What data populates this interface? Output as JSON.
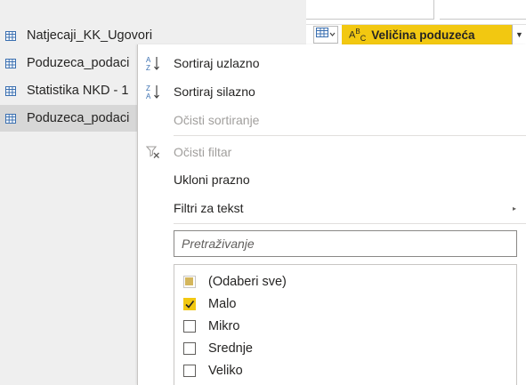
{
  "queries": [
    {
      "label": "Natjecaji_KK_Ugovori",
      "selected": false
    },
    {
      "label": "Poduzeca_podaci",
      "selected": false
    },
    {
      "label": "Statistika NKD - 1",
      "selected": false
    },
    {
      "label": "Poduzeca_podaci",
      "selected": true
    }
  ],
  "column": {
    "type_label": "A",
    "type_sup": "B",
    "type_sub": "C",
    "name": "Veličina poduzeća",
    "dropdown_glyph": "▼"
  },
  "menu": {
    "sort_asc": "Sortiraj uzlazno",
    "sort_desc": "Sortiraj silazno",
    "clear_sort": "Očisti sortiranje",
    "clear_filter": "Očisti filtar",
    "remove_empty": "Ukloni prazno",
    "text_filters": "Filtri za tekst",
    "submenu_glyph": "▸",
    "search_placeholder": "Pretraživanje",
    "options": [
      {
        "label": "(Odaberi sve)",
        "state": "indeterminate"
      },
      {
        "label": "Malo",
        "state": "checked"
      },
      {
        "label": "Mikro",
        "state": "unchecked"
      },
      {
        "label": "Srednje",
        "state": "unchecked"
      },
      {
        "label": "Veliko",
        "state": "unchecked"
      }
    ]
  },
  "colors": {
    "accent": "#f2c811",
    "selected_row": "#d7d7d7",
    "pane_bg": "#efefef"
  }
}
